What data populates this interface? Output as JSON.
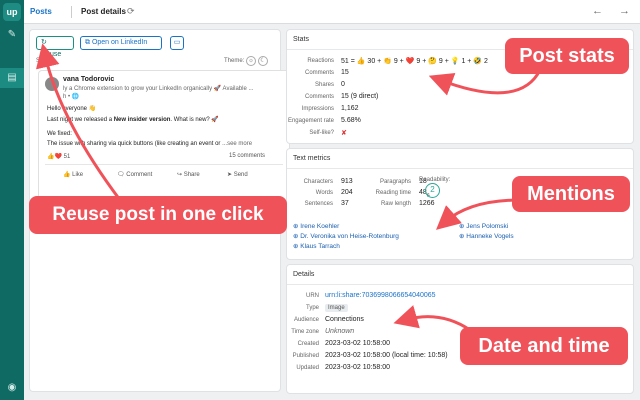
{
  "sidebar": {
    "logo": "up",
    "icons": [
      "edit-icon",
      "posts-icon",
      "user-icon"
    ]
  },
  "topbar": {
    "crumb_posts": "Posts",
    "crumb_current": "Post details"
  },
  "left": {
    "reuse_label": "Reuse",
    "linkedin_label": "Open on LinkedIn",
    "size_label": "Size:",
    "theme_label": "Theme:",
    "post": {
      "author": "vana Todorovic",
      "author_sub": "ly a Chrome extension to grow your LinkedIn organically 🚀 Available ...",
      "author_meta": "h • 🌐",
      "line1": "Hello everyone 👋",
      "line2a": "Last night we released a ",
      "line2b": "New insider version",
      "line2c": ". What is new? 🚀",
      "line3": "We fixed:",
      "line4": "The issue with sharing via quick buttons (like creating an event or ",
      "line4_more": "...see more",
      "reactions": "👍❤️ 51",
      "comments": "15 comments",
      "act_like": "Like",
      "act_comment": "Comment",
      "act_share": "Share",
      "act_send": "Send"
    }
  },
  "stats": {
    "title": "Stats",
    "rows": [
      {
        "k": "Reactions",
        "v": "51 = 👍 30 + 👏 9 + ❤️ 9 + 🤔 9 + 💡 1 + 🤣 2"
      },
      {
        "k": "Comments",
        "v": "15"
      },
      {
        "k": "Shares",
        "v": "0"
      },
      {
        "k": "Comments",
        "v": "15 (9 direct)"
      },
      {
        "k": "Impressions",
        "v": "1,162"
      },
      {
        "k": "Engagement rate",
        "v": "5.68%"
      },
      {
        "k": "Self-like?",
        "v": "✘"
      }
    ]
  },
  "text_metrics": {
    "title": "Text metrics",
    "characters_k": "Characters",
    "characters_v": "913",
    "words_k": "Words",
    "words_v": "204",
    "sentences_k": "Sentences",
    "sentences_v": "37",
    "paragraphs_k": "Paragraphs",
    "paragraphs_v": "18",
    "reading_k": "Reading time",
    "reading_v": "48",
    "reading_unit": "s",
    "rawlen_k": "Raw length",
    "rawlen_v": "1266",
    "readability_k": "Readability:",
    "readability_v": "2",
    "mentions": [
      "Irene Koehler",
      "Dr. Veronika von Heise-Rotenburg",
      "Klaus Tarrach",
      "Jens Polomski",
      "Hanneke Vogels"
    ]
  },
  "details": {
    "title": "Details",
    "rows": [
      {
        "k": "URN",
        "v": "urn:li:share:7036998066654040065"
      },
      {
        "k": "Type",
        "v": "Image"
      },
      {
        "k": "Audience",
        "v": "Connections"
      },
      {
        "k": "Time zone",
        "v": "Unknown"
      },
      {
        "k": "Created",
        "v": "2023-03-02 10:58:00"
      },
      {
        "k": "Published",
        "v": "2023-03-02 10:58:00 (local time: 10:58)"
      },
      {
        "k": "Updated",
        "v": "2023-03-02 10:58:00"
      }
    ]
  },
  "callouts": {
    "post_stats": "Post stats",
    "mentions": "Mentions",
    "date_time": "Date and time",
    "reuse": "Reuse post in one click"
  },
  "colors": {
    "accent": "#0f6a63",
    "callout": "#f0525a",
    "link": "#1a73c7"
  }
}
